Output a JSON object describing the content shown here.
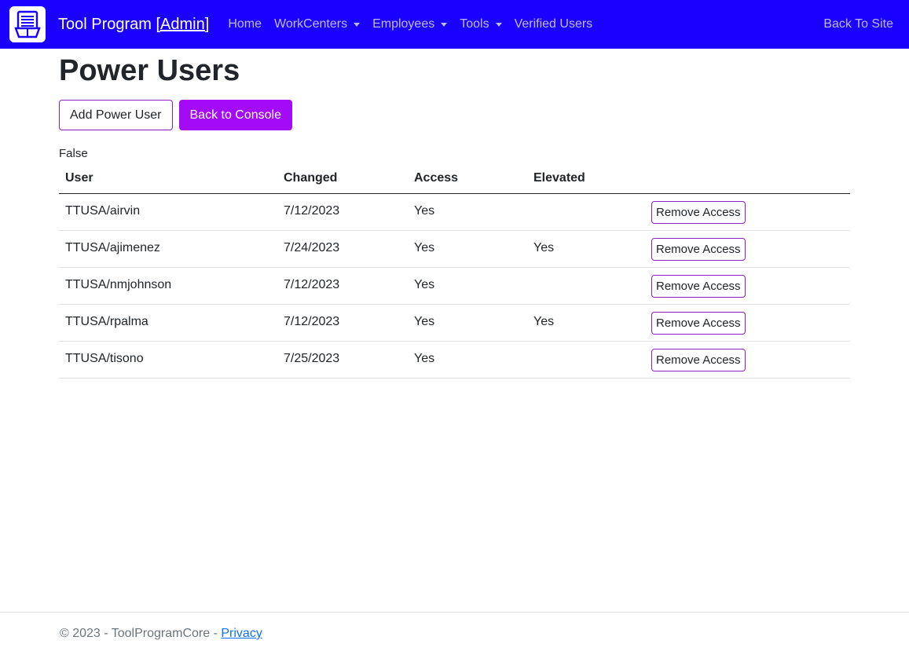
{
  "navbar": {
    "logo_icon": "document-icon",
    "brand": "Tool Program",
    "brand_admin": "[Admin]",
    "links": [
      {
        "label": "Home",
        "dropdown": false
      },
      {
        "label": "WorkCenters",
        "dropdown": true
      },
      {
        "label": "Employees",
        "dropdown": true
      },
      {
        "label": "Tools",
        "dropdown": true
      },
      {
        "label": "Verified Users",
        "dropdown": false
      }
    ],
    "back_to_site": "Back To Site"
  },
  "page": {
    "title": "Power Users",
    "add_button": "Add Power User",
    "console_button": "Back to Console",
    "flag_text": "False"
  },
  "table": {
    "headers": [
      "User",
      "Changed",
      "Access",
      "Elevated",
      ""
    ],
    "rows": [
      {
        "user": "TTUSA/airvin",
        "changed": "7/12/2023",
        "access": "Yes",
        "elevated": "",
        "action": "Remove Access"
      },
      {
        "user": "TTUSA/ajimenez",
        "changed": "7/24/2023",
        "access": "Yes",
        "elevated": "Yes",
        "action": "Remove Access"
      },
      {
        "user": "TTUSA/nmjohnson",
        "changed": "7/12/2023",
        "access": "Yes",
        "elevated": "",
        "action": "Remove Access"
      },
      {
        "user": "TTUSA/rpalma",
        "changed": "7/12/2023",
        "access": "Yes",
        "elevated": "Yes",
        "action": "Remove Access"
      },
      {
        "user": "TTUSA/tisono",
        "changed": "7/25/2023",
        "access": "Yes",
        "elevated": "",
        "action": "Remove Access"
      }
    ]
  },
  "footer": {
    "copyright": "© 2023 - ToolProgramCore - ",
    "privacy": "Privacy"
  },
  "colors": {
    "navbar_bg": "#1a00ff",
    "primary_button": "#a30af5",
    "outline_border": "#8b1fc1"
  }
}
